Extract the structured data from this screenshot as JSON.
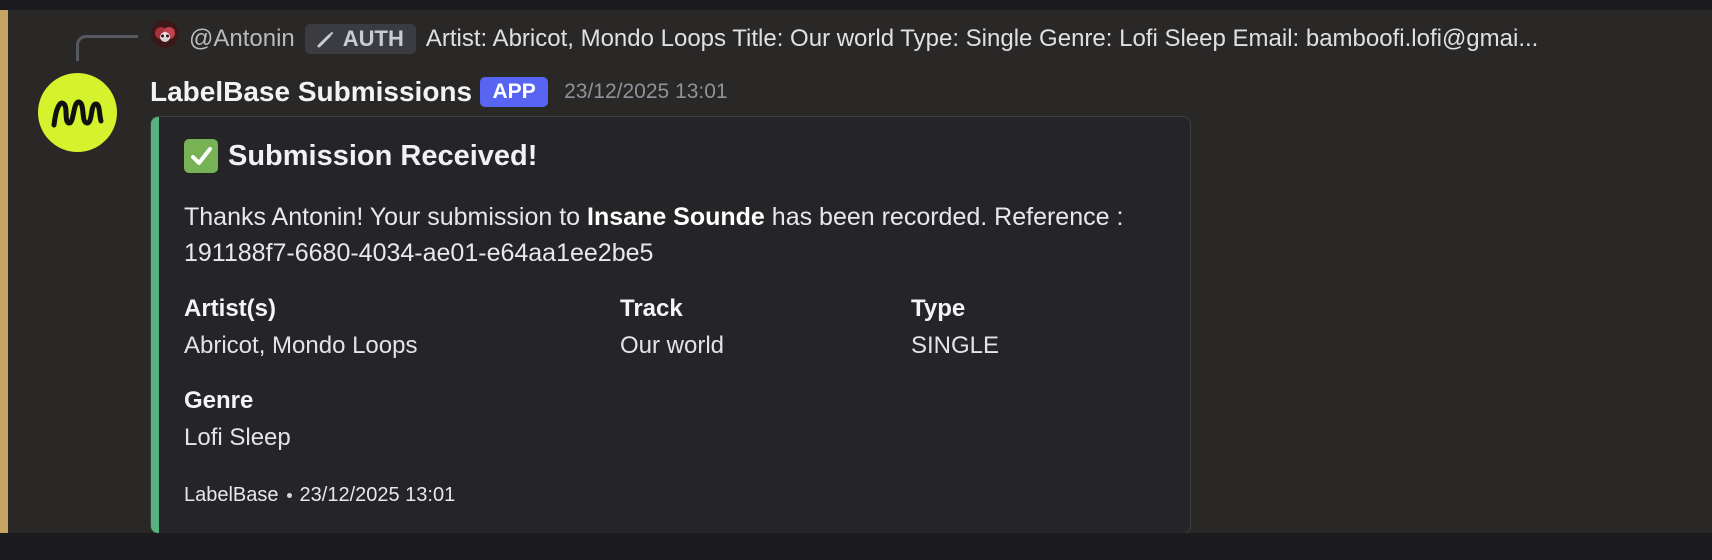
{
  "reply": {
    "user": "@Antonin",
    "badge_label": "AUTH",
    "preview": "Artist: Abricot, Mondo Loops Title: Our world Type: Single Genre: Lofi Sleep Email: bamboofi.lofi@gmai..."
  },
  "message": {
    "author": "LabelBase Submissions",
    "app_badge": "APP",
    "timestamp": "23/12/2025 13:01"
  },
  "embed": {
    "title": "Submission Received!",
    "description_before": "Thanks Antonin! Your submission to ",
    "description_label": "Insane Sounde",
    "description_after": " has been recorded. Reference : 191188f7-6680-4034-ae01-e64aa1ee2be5",
    "fields": {
      "artist": {
        "name": "Artist(s)",
        "value": "Abricot, Mondo Loops"
      },
      "track": {
        "name": "Track",
        "value": "Our world"
      },
      "type": {
        "name": "Type",
        "value": "SINGLE"
      },
      "genre": {
        "name": "Genre",
        "value": "Lofi Sleep"
      }
    },
    "footer": {
      "provider": "LabelBase",
      "timestamp": "23/12/2025 13:01"
    }
  },
  "icons": {
    "reply_avatar": "mini-bot-avatar-icon",
    "auth": "brush-icon",
    "bot_logo": "wave-logo-icon",
    "success": "check-mark-icon"
  },
  "colors": {
    "mention_highlight": "#c8a463",
    "app_badge": "#5865f2",
    "embed_accent": "#57b37d",
    "bot_avatar": "#d5f32c"
  }
}
